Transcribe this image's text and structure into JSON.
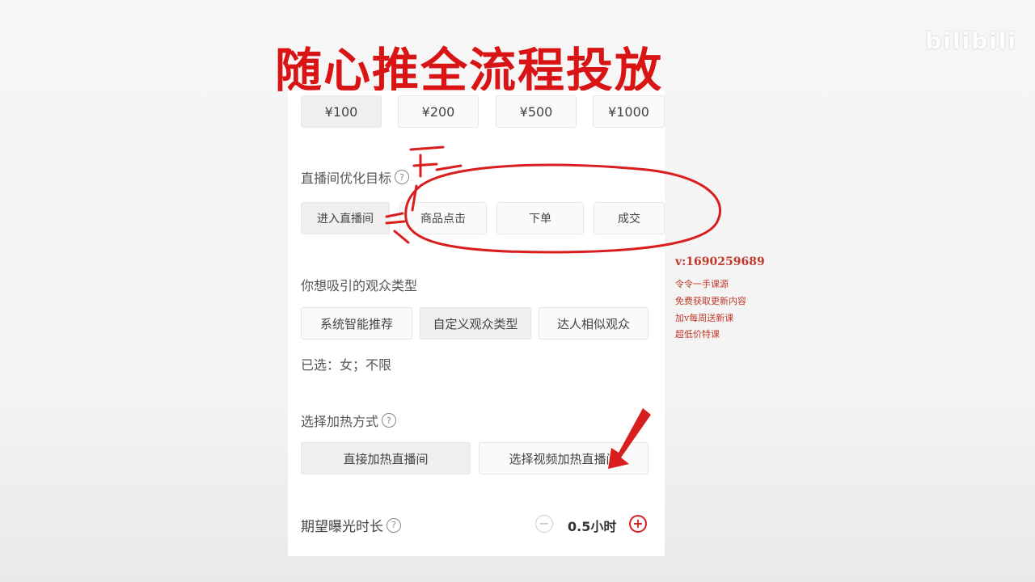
{
  "title": "随心推全流程投放",
  "watermark": "bilibili",
  "budget": {
    "options": [
      "¥100",
      "¥200",
      "¥500",
      "¥1000"
    ]
  },
  "goal": {
    "label": "直播间优化目标",
    "options": [
      "进入直播间",
      "商品点击",
      "下单",
      "成交"
    ]
  },
  "audience": {
    "label": "你想吸引的观众类型",
    "options": [
      "系统智能推荐",
      "自定义观众类型",
      "达人相似观众"
    ],
    "selected_text": "已选：女；不限"
  },
  "heat": {
    "label": "选择加热方式",
    "options": [
      "直接加热直播间",
      "选择视频加热直播间"
    ]
  },
  "duration": {
    "label": "期望曝光时长",
    "value": "0.5小时"
  },
  "side_notes": [
    "v:1690259689",
    "令令一手课源",
    "免费获取更新内容",
    "加v每周送新课",
    "超低价特课"
  ],
  "colors": {
    "title_red": "#d91414",
    "annotation_red": "#d81e1e",
    "note_red": "#c0392b"
  }
}
